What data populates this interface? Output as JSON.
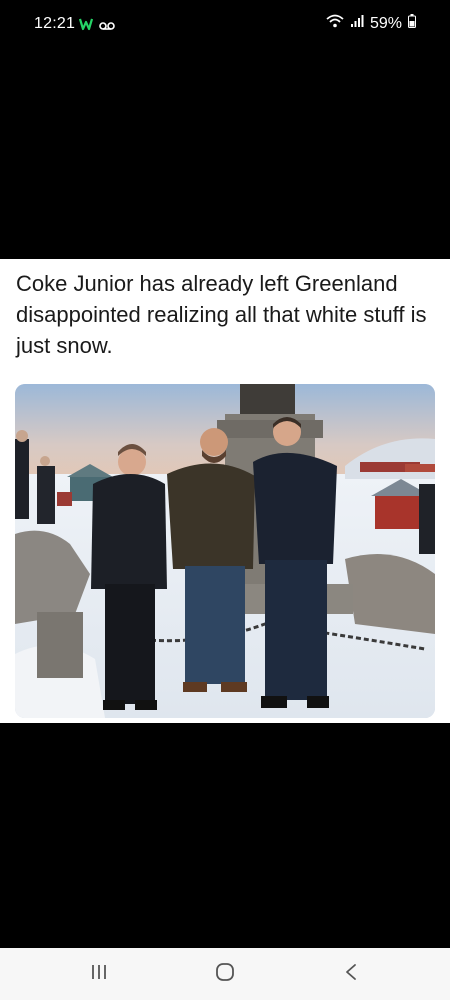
{
  "status_bar": {
    "time": "12:21",
    "battery": "59%",
    "icons": [
      "whatsapp-icon",
      "voicemail-icon",
      "wifi-icon",
      "signal-icon",
      "battery-icon"
    ]
  },
  "post": {
    "caption": "Coke Junior has already left Greenland disappointed realizing all that white stuff is just snow."
  },
  "nav_bar": {
    "buttons": [
      "recent-apps-button",
      "home-button",
      "back-button"
    ]
  },
  "colors": {
    "background": "#000000",
    "card": "#ffffff",
    "nav_bar": "#f7f7f7",
    "whatsapp_accent": "#25d366"
  }
}
